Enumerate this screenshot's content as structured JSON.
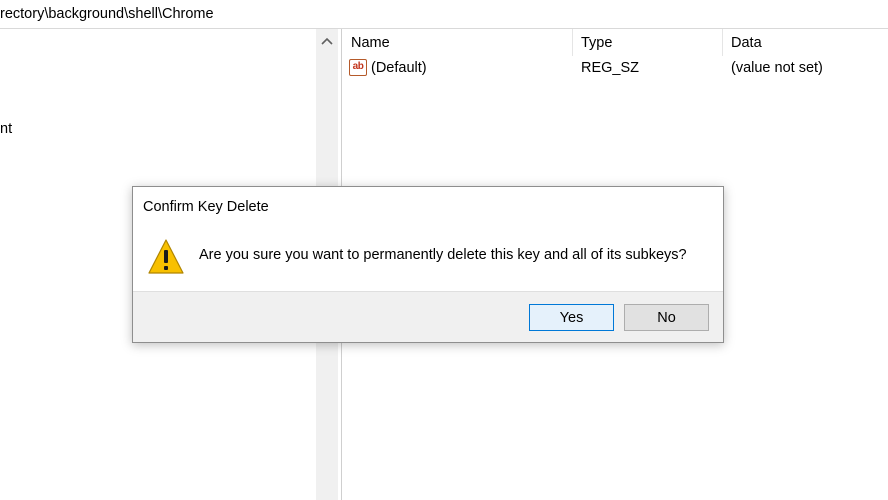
{
  "address_bar": {
    "path": "rectory\\background\\shell\\Chrome"
  },
  "tree": {
    "partial_item": "nt"
  },
  "values_pane": {
    "columns": [
      "Name",
      "Type",
      "Data"
    ],
    "rows": [
      {
        "icon": "string-value-icon",
        "icon_text": "ab",
        "name": "(Default)",
        "type": "REG_SZ",
        "data": "(value not set)"
      }
    ]
  },
  "dialog": {
    "title": "Confirm Key Delete",
    "icon": "warning-icon",
    "message": "Are you sure you want to permanently delete this key and all of its subkeys?",
    "buttons": {
      "yes": "Yes",
      "no": "No"
    }
  },
  "colors": {
    "focus_blue": "#0078d7",
    "warning_yellow": "#f8c000"
  }
}
